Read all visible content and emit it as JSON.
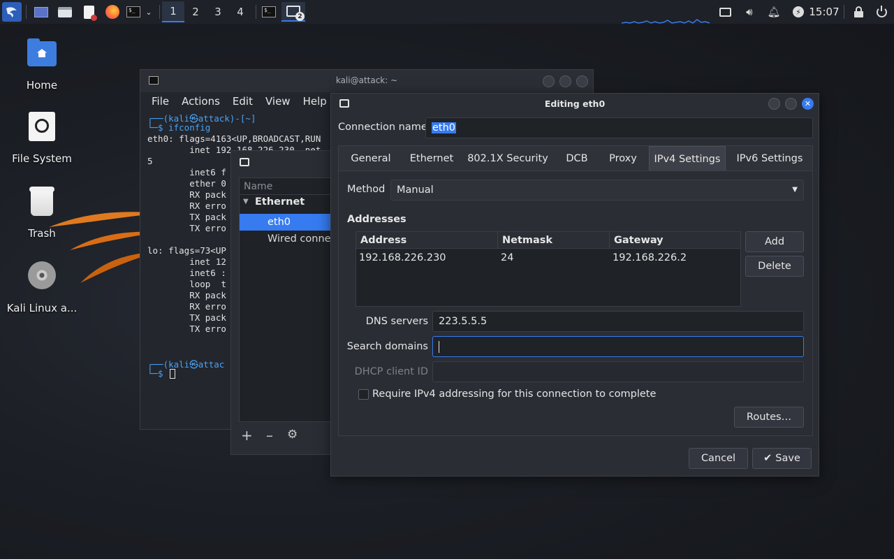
{
  "panel": {
    "workspaces": [
      "1",
      "2",
      "3",
      "4"
    ],
    "active_workspace": "1",
    "clock": "15:07",
    "nm_badge": "2"
  },
  "desktop": {
    "icons": [
      {
        "label": "Home"
      },
      {
        "label": "File System"
      },
      {
        "label": "Trash"
      },
      {
        "label": "Kali Linux a..."
      }
    ]
  },
  "terminal": {
    "title": "kali@attack: ~",
    "menu": [
      "File",
      "Actions",
      "Edit",
      "View",
      "Help"
    ],
    "lines": [
      "┌──(kali㉿attack)-[~]",
      "└─$ ifconfig",
      "eth0: flags=4163<UP,BROADCAST,RUN",
      "        inet 192.168.226.230  net",
      "5",
      "        inet6 f",
      "        ether 0",
      "        RX pack",
      "        RX erro",
      "        TX pack",
      "        TX erro",
      "",
      "lo: flags=73<UP",
      "        inet 12",
      "        inet6 :",
      "        loop  t",
      "        RX pack",
      "        RX erro",
      "        TX pack",
      "        TX erro",
      "",
      "",
      "┌──(kali㉿attac",
      "└─$ "
    ]
  },
  "nm_list": {
    "column_header": "Name",
    "group": "Ethernet",
    "items": [
      "eth0",
      "Wired connect"
    ],
    "selected": "eth0"
  },
  "dialog": {
    "title": "Editing eth0",
    "connection_name_label": "Connection name",
    "connection_name": "eth0",
    "tabs": [
      "General",
      "Ethernet",
      "802.1X Security",
      "DCB",
      "Proxy",
      "IPv4 Settings",
      "IPv6 Settings"
    ],
    "active_tab": "IPv4 Settings",
    "method_label": "Method",
    "method": "Manual",
    "addresses_label": "Addresses",
    "columns": [
      "Address",
      "Netmask",
      "Gateway"
    ],
    "rows": [
      {
        "address": "192.168.226.230",
        "netmask": "24",
        "gateway": "192.168.226.2"
      }
    ],
    "add_label": "Add",
    "delete_label": "Delete",
    "dns_label": "DNS servers",
    "dns": "223.5.5.5",
    "search_label": "Search domains",
    "search": "",
    "dhcp_label": "DHCP client ID",
    "dhcp": "",
    "require_label": "Require IPv4 addressing for this connection to complete",
    "require_checked": false,
    "routes_label": "Routes…",
    "cancel_label": "Cancel",
    "save_label": "Save"
  },
  "colors": {
    "accent": "#367bf0",
    "panel_bg": "#1e2127",
    "window_bg": "#2a2d34"
  }
}
